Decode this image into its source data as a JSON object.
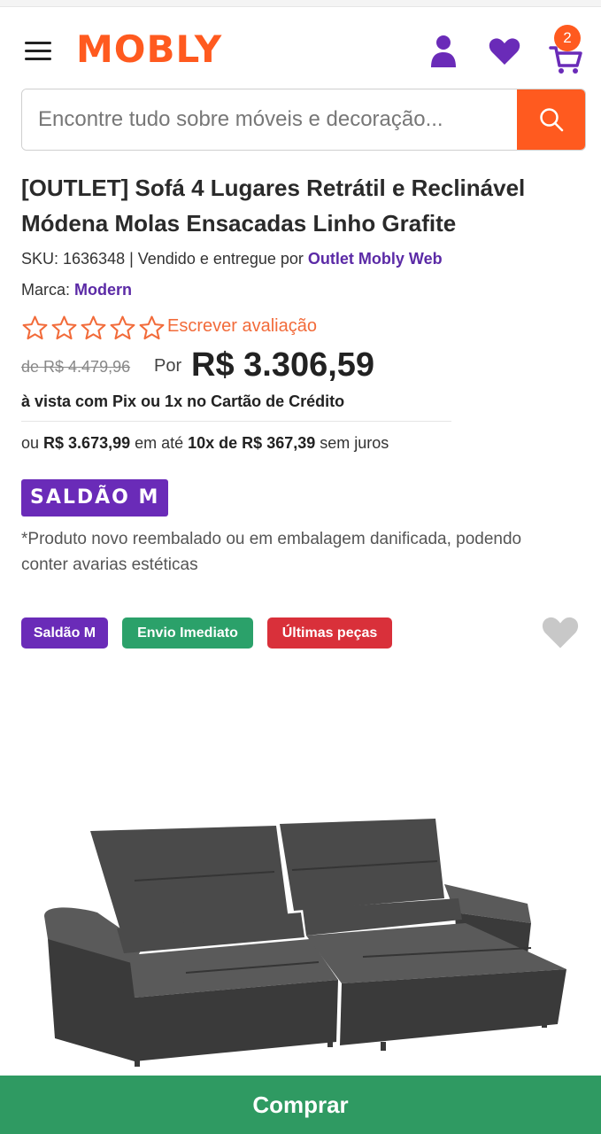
{
  "header": {
    "logo_text": "MOBLY",
    "cart_count": "2",
    "icons": [
      "menu-icon",
      "user-icon",
      "heart-icon",
      "cart-icon"
    ]
  },
  "search": {
    "placeholder": "Encontre tudo sobre móveis e decoração...",
    "value": ""
  },
  "product": {
    "title": "[OUTLET] Sofá 4 Lugares Retrátil e Reclinável Módena Molas Ensacadas Linho Grafite",
    "sku_label": "SKU: 1636348 | Vendido e entregue por ",
    "seller": "Outlet Mobly Web",
    "brand_label": "Marca: ",
    "brand": "Modern",
    "rating_stars": 5,
    "rating_value": 0,
    "review_link": "Escrever avaliação",
    "old_price": "de R$ 4.479,96",
    "por_label": "Por",
    "price": "R$ 3.306,59",
    "pix_text": "à vista com Pix ou 1x no Cartão de Crédito",
    "installments": {
      "prefix": "ou ",
      "total": "R$ 3.673,99",
      "middle": " em até ",
      "plan": "10x de R$ 367,39",
      "suffix": " sem juros"
    },
    "saldao_badge": "SALDÃO M",
    "note": "*Produto novo reembalado ou em embalagem danificada, podendo conter avarias estéticas",
    "tags": [
      "Saldão M",
      "Envio Imediato",
      "Últimas peças"
    ]
  },
  "buy_button": "Comprar",
  "colors": {
    "brand_orange": "#ff5a1f",
    "purple": "#6a2bb8",
    "link_purple": "#5b2aa6",
    "star_orange": "#f26b3a",
    "green": "#2ba16a",
    "red": "#d9303a",
    "buy_green": "#2f9a62",
    "fav_gray": "#c8c8c8",
    "sofa_gray": "#4a4a4a"
  }
}
